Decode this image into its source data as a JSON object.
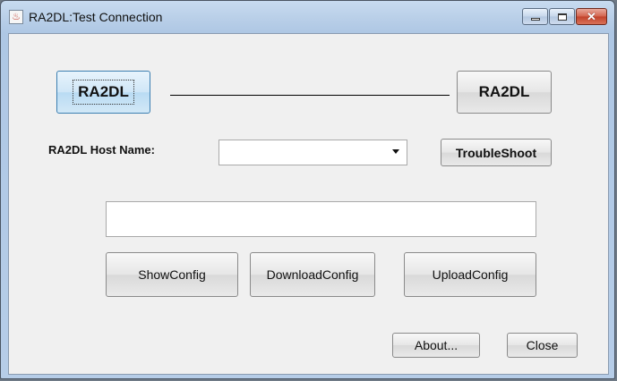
{
  "window": {
    "title": "RA2DL:Test Connection",
    "icon": "java-cup-icon",
    "controls": {
      "minimize": "minimize-icon",
      "maximize": "maximize-icon",
      "close": "close-icon"
    }
  },
  "connection": {
    "left_label": "RA2DL",
    "right_label": "RA2DL"
  },
  "host": {
    "label": "RA2DL Host Name:",
    "selected_value": ""
  },
  "troubleshoot_label": "TroubleShoot",
  "output_field": {
    "value": ""
  },
  "config_buttons": {
    "show": "ShowConfig",
    "download": "DownloadConfig",
    "upload": "UploadConfig"
  },
  "footer": {
    "about": "About...",
    "close": "Close"
  }
}
